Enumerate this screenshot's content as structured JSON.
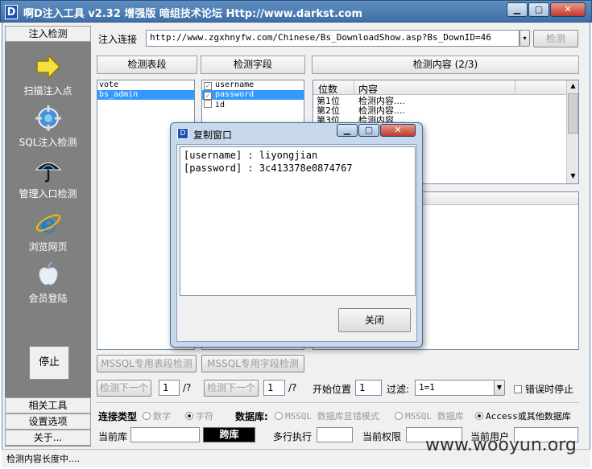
{
  "window": {
    "title": "啊D注入工具 v2.32 增强版 暗组技术论坛 Http://www.darkst.com",
    "app_icon": "D"
  },
  "sidebar": {
    "header": "注入检测",
    "items": [
      {
        "label": "扫描注入点",
        "icon": "arrow-right-icon"
      },
      {
        "label": "SQL注入检测",
        "icon": "globe-target-icon"
      },
      {
        "label": "管理入口检测",
        "icon": "umbrella-icon"
      },
      {
        "label": "浏览网页",
        "icon": "internet-explorer-icon"
      },
      {
        "label": "会员登陆",
        "icon": "apple-icon"
      }
    ],
    "stop_label": "停止",
    "footer": [
      "相关工具",
      "设置选项",
      "关于..."
    ]
  },
  "toolbar": {
    "url_label": "注入连接",
    "url_value": "http://www.zgxhnyfw.com/Chinese/Bs_DownloadShow.asp?Bs_DownID=46",
    "detect_button": "检测"
  },
  "panels": {
    "tables_header": "检测表段",
    "fields_header": "检测字段",
    "content_header": "检测内容 (2/3)",
    "tables": [
      {
        "name": "vote",
        "selected": false
      },
      {
        "name": "bs_admin",
        "selected": true
      }
    ],
    "fields": [
      {
        "name": "username",
        "checked": true,
        "selected": false
      },
      {
        "name": "password",
        "checked": true,
        "selected": true
      },
      {
        "name": "id",
        "checked": false,
        "selected": false
      }
    ],
    "content_columns": [
      "位数",
      "内容"
    ],
    "content_rows": [
      {
        "pos": "第1位",
        "value": "检测内容...."
      },
      {
        "pos": "第2位",
        "value": "检测内容...."
      },
      {
        "pos": "第3位",
        "value": "检测内容...."
      }
    ]
  },
  "buttons": {
    "mssql_tables": "MSSQL专用表段检测",
    "mssql_fields": "MSSQL专用字段检测",
    "next1": "检测下一个",
    "next2": "检测下一个"
  },
  "options": {
    "next1_value": "1",
    "next1_suffix": "/?",
    "next2_value": "1",
    "next2_suffix": "/?",
    "start_label": "开始位置",
    "start_value": "1",
    "filter_label": "过滤:",
    "filter_value": "1=1",
    "stop_on_error": "错误时停止"
  },
  "connection": {
    "type_label": "连接类型",
    "type_numeric": "数字",
    "type_string": "字符",
    "db_label": "数据库:",
    "db_options": [
      {
        "label": "MSSQL 数据库显错模式",
        "on": false
      },
      {
        "label": "MSSQL 数据库",
        "on": false
      },
      {
        "label": "Access或其他数据库",
        "on": true
      }
    ],
    "current_db_label": "当前库",
    "current_db_value": "",
    "cross_db_button": "跨库",
    "multi_exec_label": "多行执行",
    "current_perm_label": "当前权限",
    "current_user_label": "当前用户"
  },
  "status": {
    "text": "检测内容长度中...."
  },
  "dialog": {
    "title": "复制窗口",
    "lines": [
      "[username] : liyongjian",
      "[password] : 3c413378e0874767"
    ],
    "close_button": "关闭"
  },
  "watermark": "www.wooyun.org"
}
